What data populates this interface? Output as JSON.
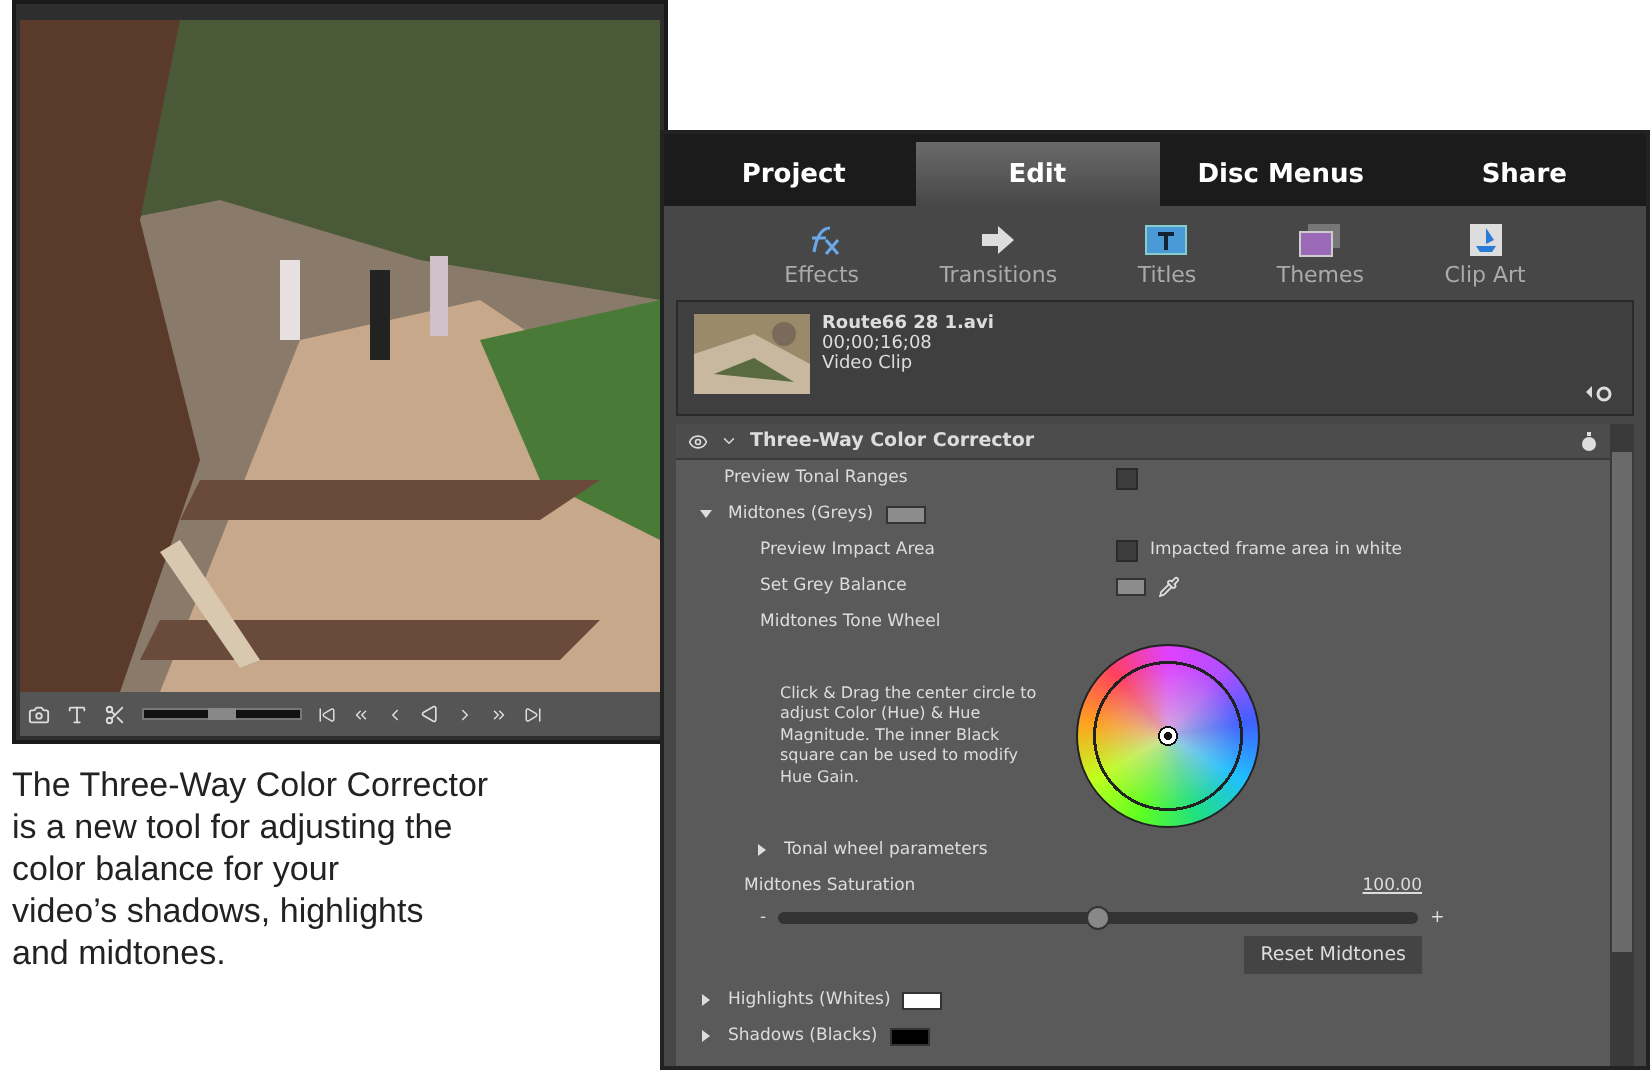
{
  "video_window": {
    "shuttle": {
      "level": 0.5
    }
  },
  "caption": "The Three-Way Color Corrector\nis a new tool for adjusting the\ncolor balance for your\nvideo’s shadows, highlights\nand midtones.",
  "panel": {
    "tabs": [
      {
        "label": "Project",
        "selected": false
      },
      {
        "label": "Edit",
        "selected": true
      },
      {
        "label": "Disc Menus",
        "selected": false
      },
      {
        "label": "Share",
        "selected": false
      }
    ],
    "tools": [
      {
        "label": "Effects",
        "kind": "fx"
      },
      {
        "label": "Transitions",
        "kind": "arrow"
      },
      {
        "label": "Titles",
        "kind": "titles"
      },
      {
        "label": "Themes",
        "kind": "themes"
      },
      {
        "label": "Clip Art",
        "kind": "clipart"
      }
    ],
    "clip": {
      "name": "Route66 28 1.avi",
      "time": "00;00;16;08",
      "type": "Video Clip"
    },
    "effect": {
      "title": "Three-Way Color Corrector",
      "expanded": true,
      "preview_tonal_ranges": {
        "label": "Preview Tonal Ranges",
        "checked": false
      },
      "midtones": {
        "label": "Midtones (Greys)",
        "expanded": true,
        "color": "#8c8c8c",
        "preview_impact": {
          "label": "Preview Impact Area",
          "checked": false,
          "note": "Impacted frame area in white"
        },
        "grey_balance": {
          "label": "Set Grey Balance",
          "color": "#8c8c8c"
        },
        "tone_wheel": {
          "label": "Midtones Tone Wheel",
          "help": "Click & Drag the center circle to adjust Color (Hue) & Hue Magnitude. The inner Black square can be used to modify Hue Gain."
        },
        "tonal_params": {
          "label": "Tonal wheel parameters",
          "expanded": false
        },
        "saturation": {
          "label": "Midtones Saturation",
          "value": "100.00",
          "min": "-",
          "max": "+",
          "level": 0.5
        },
        "reset": "Reset Midtones"
      },
      "sections": [
        {
          "label": "Highlights (Whites)",
          "expanded": false,
          "color": "#ffffff"
        },
        {
          "label": "Shadows (Blacks)",
          "expanded": false,
          "color": "#000000"
        }
      ]
    }
  }
}
